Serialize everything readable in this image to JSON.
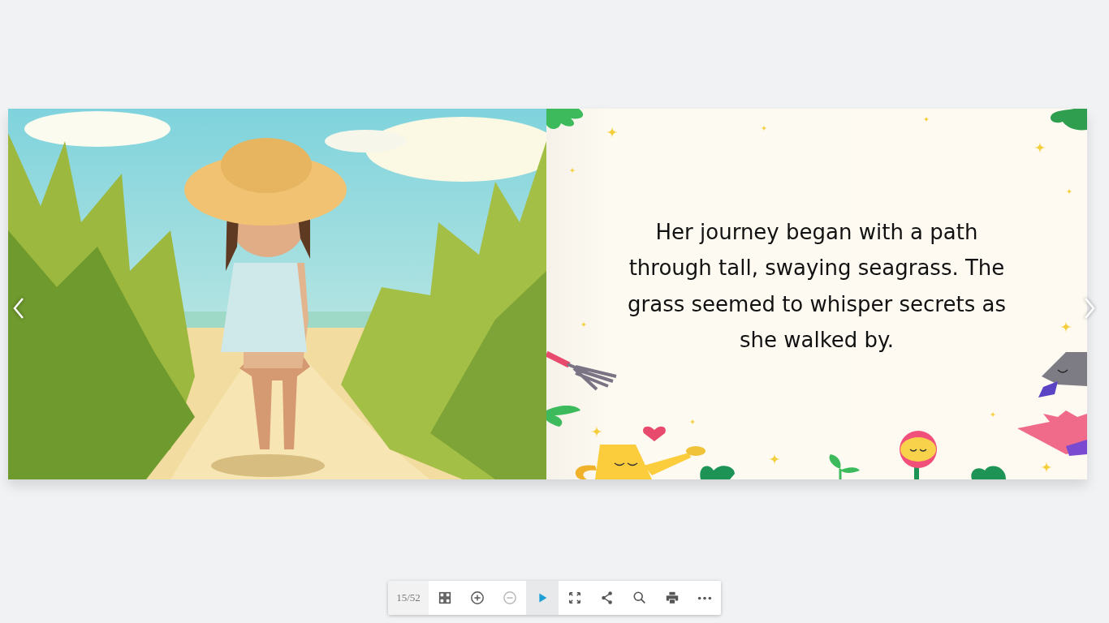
{
  "viewer": {
    "right_page": {
      "text": "Her journey began with a path through tall, swaying seagrass. The grass seemed to whisper secrets as she walked by."
    }
  },
  "toolbar": {
    "page_counter": "15/52",
    "buttons": [
      {
        "kind": "thumbnails",
        "disabled": false,
        "active": false
      },
      {
        "kind": "zoom-in",
        "disabled": false,
        "active": false
      },
      {
        "kind": "zoom-out",
        "disabled": true,
        "active": false
      },
      {
        "kind": "play",
        "disabled": false,
        "active": true
      },
      {
        "kind": "fullscreen",
        "disabled": false,
        "active": false
      },
      {
        "kind": "share",
        "disabled": false,
        "active": false
      },
      {
        "kind": "search",
        "disabled": false,
        "active": false
      },
      {
        "kind": "print",
        "disabled": false,
        "active": false
      },
      {
        "kind": "more",
        "disabled": false,
        "active": false
      }
    ]
  }
}
